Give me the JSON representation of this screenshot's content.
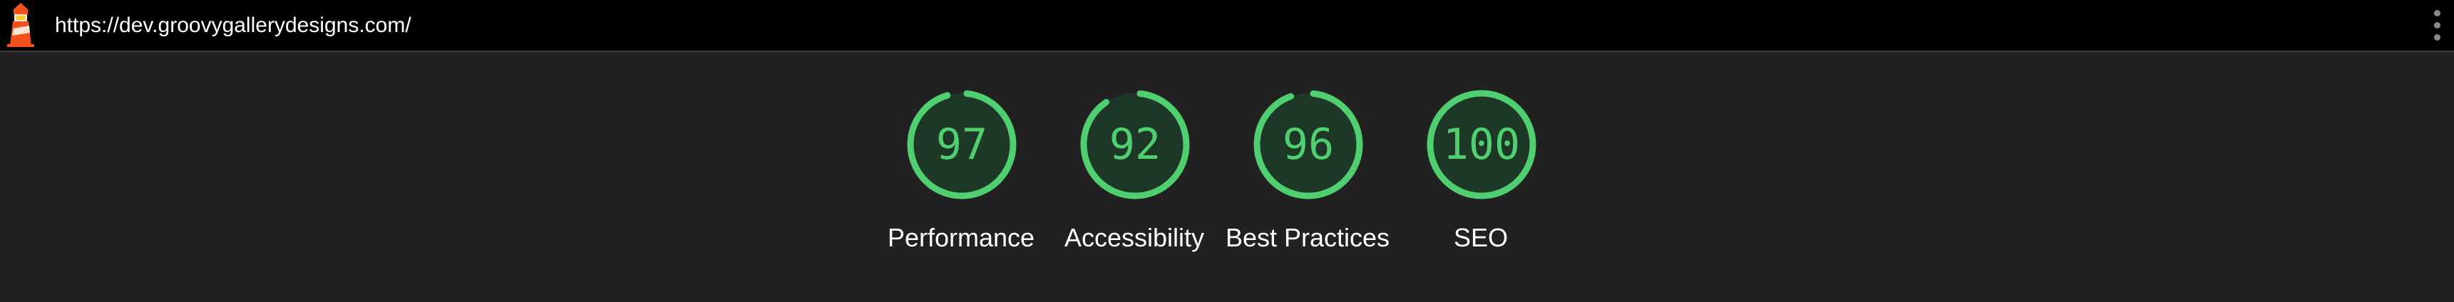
{
  "header": {
    "url": "https://dev.groovygallerydesigns.com/",
    "logo_icon": "lighthouse-icon",
    "menu_icon": "more-vertical-icon"
  },
  "colors": {
    "pass": "#4fcf6f",
    "pass_track": "#1d3826",
    "background": "#212121",
    "header_background": "#000000"
  },
  "gauges": [
    {
      "score": "97",
      "value": 97,
      "label": "Performance"
    },
    {
      "score": "92",
      "value": 92,
      "label": "Accessibility"
    },
    {
      "score": "96",
      "value": 96,
      "label": "Best Practices"
    },
    {
      "score": "100",
      "value": 100,
      "label": "SEO"
    }
  ]
}
